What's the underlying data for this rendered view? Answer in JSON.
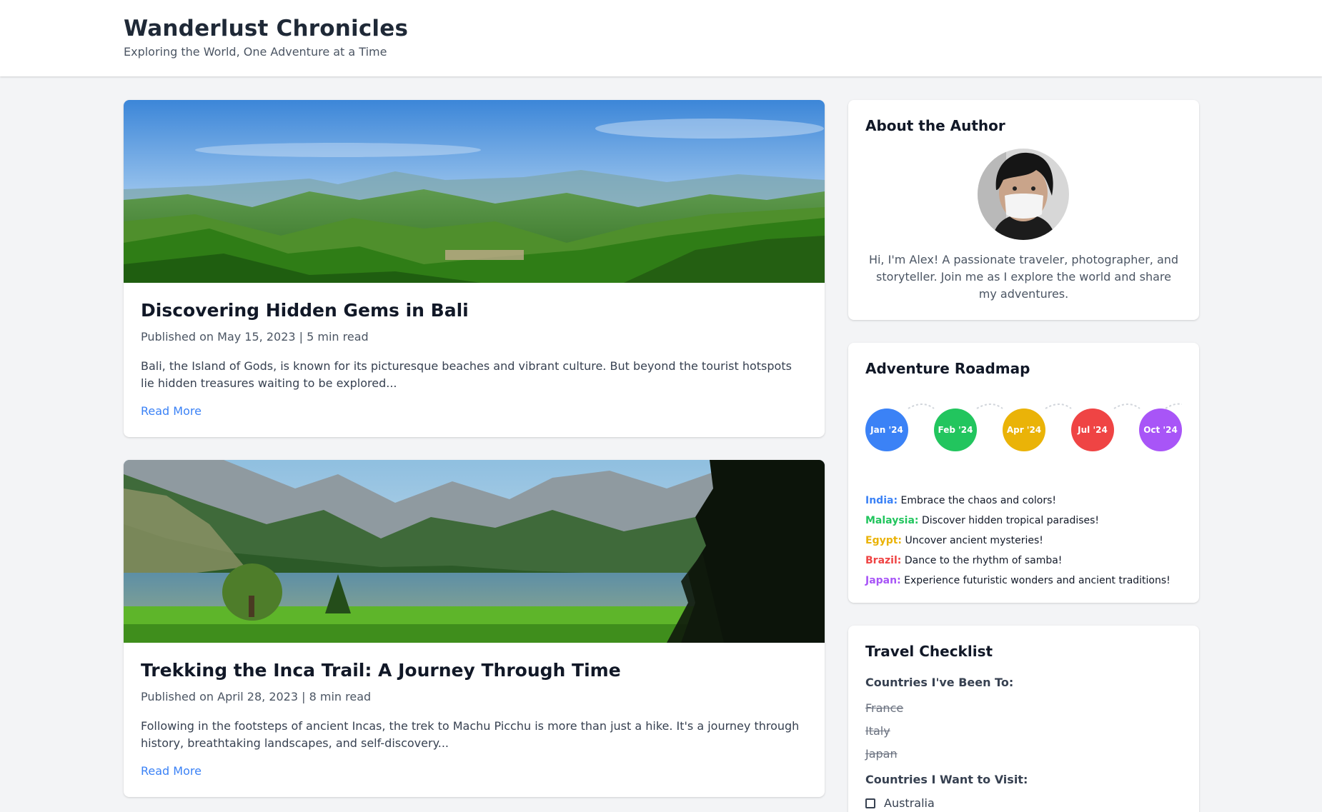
{
  "header": {
    "title": "Wanderlust Chronicles",
    "tagline": "Exploring the World, One Adventure at a Time"
  },
  "posts": [
    {
      "title": "Discovering Hidden Gems in Bali",
      "meta": "Published on May 15, 2023 | 5 min read",
      "excerpt": "Bali, the Island of Gods, is known for its picturesque beaches and vibrant culture. But beyond the tourist hotspots lie hidden treasures waiting to be explored...",
      "link": "Read More",
      "image": "green-valley-landscape-photo"
    },
    {
      "title": "Trekking the Inca Trail: A Journey Through Time",
      "meta": "Published on April 28, 2023 | 8 min read",
      "excerpt": "Following in the footsteps of ancient Incas, the trek to Machu Picchu is more than just a hike. It's a journey through history, breathtaking landscapes, and self-discovery...",
      "link": "Read More",
      "image": "mountain-lake-landscape-photo"
    }
  ],
  "about": {
    "title": "About the Author",
    "avatar": "author-portrait-masked",
    "text": "Hi, I'm Alex! A passionate traveler, photographer, and storyteller. Join me as I explore the world and share my adventures."
  },
  "roadmap": {
    "title": "Adventure Roadmap",
    "milestones": [
      {
        "label": "Jan '24",
        "color": "#3b82f6"
      },
      {
        "label": "Feb '24",
        "color": "#22c55e"
      },
      {
        "label": "Apr '24",
        "color": "#eab308"
      },
      {
        "label": "Jul '24",
        "color": "#ef4444"
      },
      {
        "label": "Oct '24",
        "color": "#a855f7"
      }
    ],
    "destinations": [
      {
        "country": "India:",
        "note": "Embrace the chaos and colors!",
        "color": "#3b82f6"
      },
      {
        "country": "Malaysia:",
        "note": "Discover hidden tropical paradises!",
        "color": "#22c55e"
      },
      {
        "country": "Egypt:",
        "note": "Uncover ancient mysteries!",
        "color": "#eab308"
      },
      {
        "country": "Brazil:",
        "note": "Dance to the rhythm of samba!",
        "color": "#ef4444"
      },
      {
        "country": "Japan:",
        "note": "Experience futuristic wonders and ancient traditions!",
        "color": "#a855f7"
      }
    ]
  },
  "checklist": {
    "title": "Travel Checklist",
    "visited_label": "Countries I've Been To:",
    "visited": [
      "France",
      "Italy",
      "Japan"
    ],
    "wish_label": "Countries I Want to Visit:",
    "wish": [
      "Australia"
    ]
  }
}
